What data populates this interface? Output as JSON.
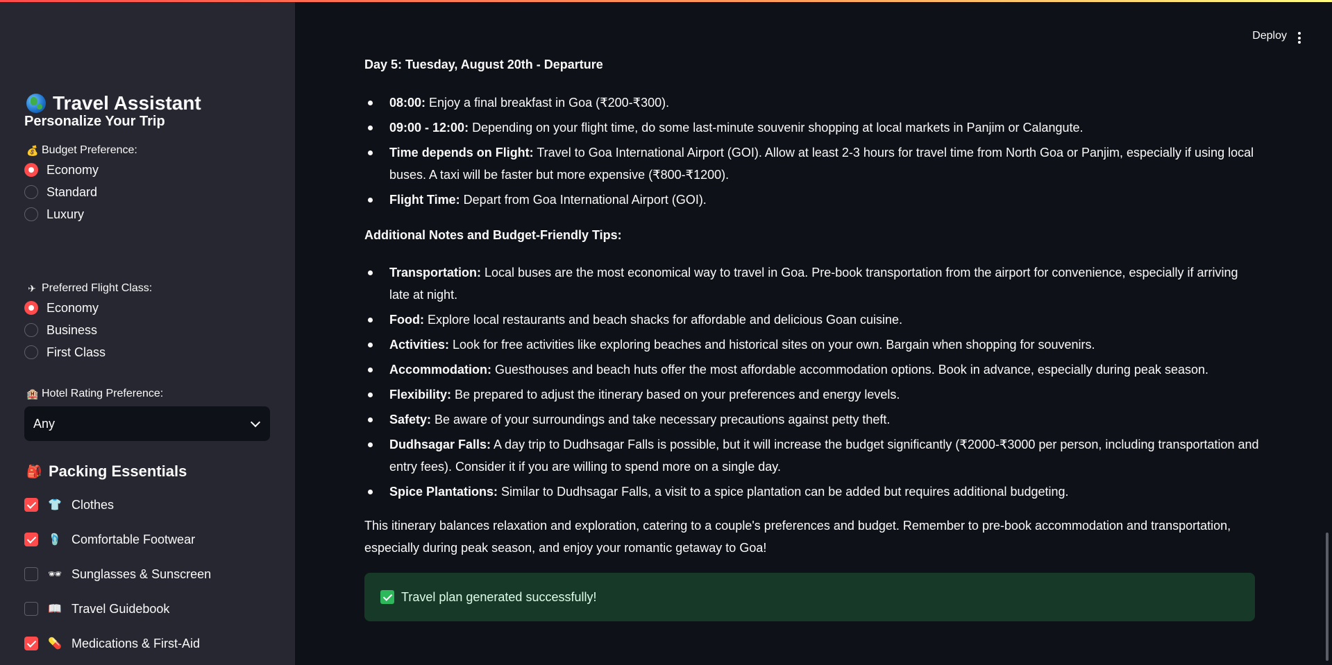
{
  "sidebar": {
    "app_title": "Travel Assistant",
    "personalize_heading": "Personalize Your Trip",
    "budget": {
      "label": "Budget Preference:",
      "options": [
        "Economy",
        "Standard",
        "Luxury"
      ],
      "selected": "Economy"
    },
    "flight_class": {
      "label": "Preferred Flight Class:",
      "options": [
        "Economy",
        "Business",
        "First Class"
      ],
      "selected": "Economy"
    },
    "hotel_rating": {
      "label": "Hotel Rating Preference:",
      "value": "Any"
    },
    "packing": {
      "heading": "Packing Essentials",
      "items": [
        {
          "label": "Clothes",
          "icon": "shirt-icon",
          "checked": true
        },
        {
          "label": "Comfortable Footwear",
          "icon": "flip-flop-icon",
          "checked": true
        },
        {
          "label": "Sunglasses & Sunscreen",
          "icon": "sunglasses-icon",
          "checked": false
        },
        {
          "label": "Travel Guidebook",
          "icon": "book-icon",
          "checked": false
        },
        {
          "label": "Medications & First-Aid",
          "icon": "pill-icon",
          "checked": true
        }
      ]
    }
  },
  "header": {
    "deploy_label": "Deploy"
  },
  "main": {
    "day_heading": "Day 5: Tuesday, August 20th - Departure",
    "day_items": [
      {
        "bold": "08:00:",
        "text": " Enjoy a final breakfast in Goa (₹200-₹300)."
      },
      {
        "bold": "09:00 - 12:00:",
        "text": " Depending on your flight time, do some last-minute souvenir shopping at local markets in Panjim or Calangute."
      },
      {
        "bold": "Time depends on Flight:",
        "text": " Travel to Goa International Airport (GOI). Allow at least 2-3 hours for travel time from North Goa or Panjim, especially if using local buses. A taxi will be faster but more expensive (₹800-₹1200)."
      },
      {
        "bold": "Flight Time:",
        "text": " Depart from Goa International Airport (GOI)."
      }
    ],
    "notes_heading": "Additional Notes and Budget-Friendly Tips:",
    "notes_items": [
      {
        "bold": "Transportation:",
        "text": " Local buses are the most economical way to travel in Goa. Pre-book transportation from the airport for convenience, especially if arriving late at night."
      },
      {
        "bold": "Food:",
        "text": " Explore local restaurants and beach shacks for affordable and delicious Goan cuisine."
      },
      {
        "bold": "Activities:",
        "text": " Look for free activities like exploring beaches and historical sites on your own. Bargain when shopping for souvenirs."
      },
      {
        "bold": "Accommodation:",
        "text": " Guesthouses and beach huts offer the most affordable accommodation options. Book in advance, especially during peak season."
      },
      {
        "bold": "Flexibility:",
        "text": " Be prepared to adjust the itinerary based on your preferences and energy levels."
      },
      {
        "bold": "Safety:",
        "text": " Be aware of your surroundings and take necessary precautions against petty theft."
      },
      {
        "bold": "Dudhsagar Falls:",
        "text": " A day trip to Dudhsagar Falls is possible, but it will increase the budget significantly (₹2000-₹3000 per person, including transportation and entry fees). Consider it if you are willing to spend more on a single day."
      },
      {
        "bold": "Spice Plantations:",
        "text": " Similar to Dudhsagar Falls, a visit to a spice plantation can be added but requires additional budgeting."
      }
    ],
    "closing": "This itinerary balances relaxation and exploration, catering to a couple's preferences and budget. Remember to pre-book accommodation and transportation, especially during peak season, and enjoy your romantic getaway to Goa!",
    "success_message": "Travel plan generated successfully!"
  },
  "colors": {
    "accent": "#ff4b4b",
    "sidebar_bg": "#262730",
    "main_bg": "#0e1117",
    "success_bg": "#173928"
  }
}
